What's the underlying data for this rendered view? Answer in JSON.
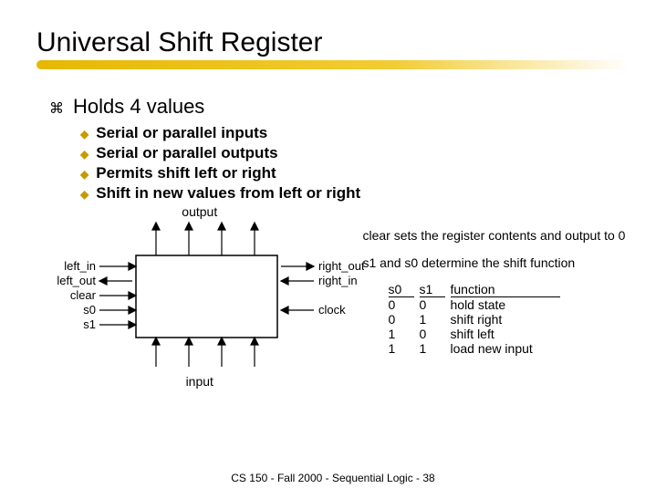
{
  "title": "Universal Shift Register",
  "bullet_main": "Holds 4 values",
  "sub_bullets": [
    "Serial or parallel inputs",
    "Serial or parallel outputs",
    "Permits shift left or right",
    "Shift in new values from left or right"
  ],
  "diagram": {
    "top_label": "output",
    "bottom_label": "input",
    "left_pins": [
      "left_in",
      "left_out",
      "clear",
      "s0",
      "s1"
    ],
    "right_pins": [
      "right_out",
      "right_in",
      "clock"
    ]
  },
  "side": {
    "clear_note": "clear sets the register contents and output to 0",
    "select_note": "s1 and s0 determine the shift function",
    "table_headers": [
      "s0",
      "s1",
      "function"
    ],
    "table_rows": [
      [
        "0",
        "0",
        "hold state"
      ],
      [
        "0",
        "1",
        "shift right"
      ],
      [
        "1",
        "0",
        "shift left"
      ],
      [
        "1",
        "1",
        "load new input"
      ]
    ]
  },
  "footer": "CS 150 - Fall 2000 - Sequential Logic - 38"
}
